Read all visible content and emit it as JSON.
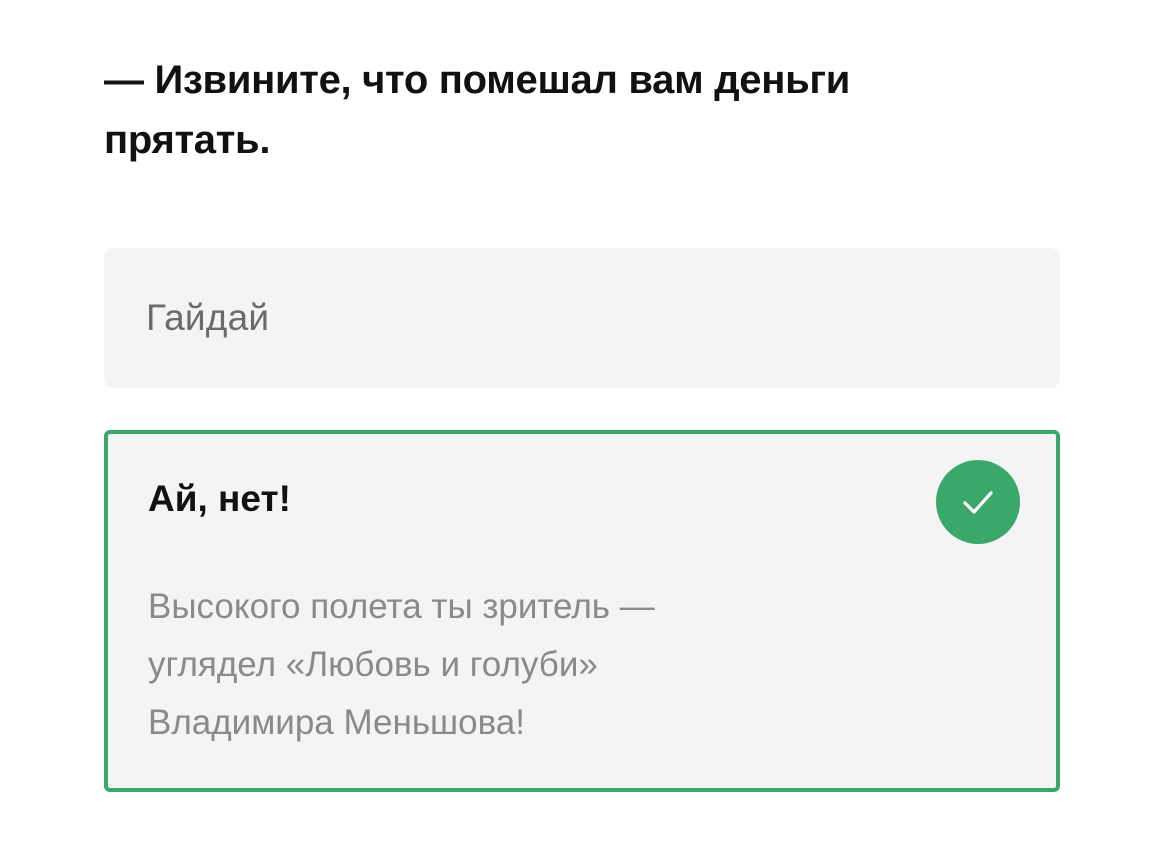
{
  "question": {
    "text": " — Извините, что помешал вам деньги прятать."
  },
  "option": {
    "label": "Гайдай"
  },
  "result": {
    "title": "Ай, нет!",
    "icon": "check-icon",
    "lines": [
      "Высокого полета ты зритель —",
      "углядел «Любовь и голуби»",
      "Владимира Меньшова!"
    ]
  },
  "colors": {
    "accent": "#3aa86b",
    "option_bg": "#f4f4f4",
    "title_text": "#111111",
    "muted_text": "#8a8a8a"
  }
}
